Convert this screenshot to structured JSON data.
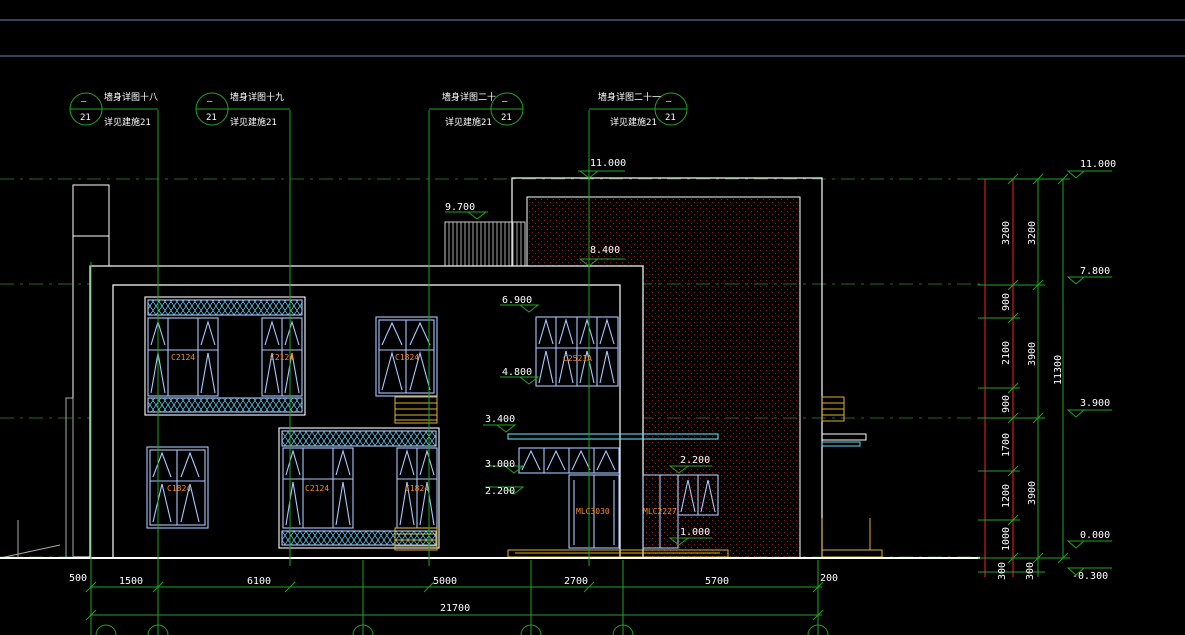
{
  "colors": {
    "background": "#000000",
    "line_white": "#ffffff",
    "axis_green": "#1fa51f",
    "window_blue": "#a8c8ff",
    "hatch_cyan": "#5fd7ff",
    "label_orange": "#ff8c1a",
    "railing_yellow": "#e0b030",
    "dim_red": "#ff2020",
    "texture_red": "#b02020"
  },
  "callouts": [
    {
      "title": "墙身详图十八",
      "ref": "详见建施21",
      "circle_top": "—",
      "circle_bottom": "21"
    },
    {
      "title": "墙身详图十九",
      "ref": "详见建施21",
      "circle_top": "—",
      "circle_bottom": "21"
    },
    {
      "title": "墙身详图二十",
      "ref": "详见建施21",
      "circle_top": "—",
      "circle_bottom": "21"
    },
    {
      "title": "墙身详图二十一",
      "ref": "详见建施21",
      "circle_top": "—",
      "circle_bottom": "21"
    }
  ],
  "window_labels": [
    "C2124",
    "C2124",
    "C1824",
    "C2521A",
    "C1824",
    "C2124",
    "C1824",
    "MLC3030",
    "MLC2227"
  ],
  "elevation_marks": [
    "11.000",
    "9.700",
    "8.400",
    "6.900",
    "4.800",
    "3.400",
    "3.000",
    "2.200",
    "2.200",
    "1.000"
  ],
  "right_elevations": [
    "11.000",
    "7.800",
    "3.900",
    "0.000",
    "-0.300"
  ],
  "vertical_dims_inner": [
    "3200",
    "900",
    "2100",
    "900",
    "1700",
    "1200",
    "1000",
    "300"
  ],
  "vertical_dims_outer": [
    "3200",
    "3900",
    "3900",
    "300"
  ],
  "vertical_total": "11300",
  "horizontal_dims": [
    "500",
    "1500",
    "6100",
    "5000",
    "2700",
    "5700",
    "200"
  ],
  "horizontal_total": "21700"
}
